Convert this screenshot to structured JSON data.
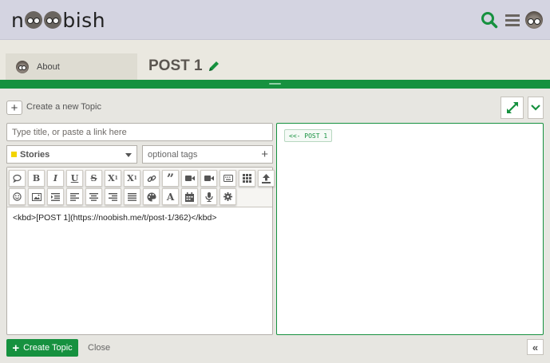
{
  "header": {
    "logo": {
      "prefix": "n",
      "suffix": "bish"
    },
    "icons": [
      "search-icon",
      "hamburger-menu-icon",
      "user-avatar-icon"
    ],
    "accent_color": "#16913f"
  },
  "subheader": {
    "about_label": "About",
    "post_title": "POST 1"
  },
  "composer": {
    "create_topic_link": "Create a new Topic",
    "title_placeholder": "Type title, or paste a link here",
    "category": {
      "name": "Stories",
      "color": "#f2d400"
    },
    "tags_placeholder": "optional tags",
    "toolbar_row1": [
      "speech-bubble-icon",
      "bold-icon",
      "italic-icon",
      "underline-icon",
      "strikethrough-icon",
      "superscript-icon",
      "subscript-icon",
      "link-icon",
      "quote-icon",
      "video-icon",
      "video-alt-icon",
      "keyboard-icon",
      "grid-icon",
      "upload-icon"
    ],
    "toolbar_row2": [
      "emoji-icon",
      "image-icon",
      "indent-icon",
      "align-left-icon",
      "align-center-icon",
      "align-right-icon",
      "justify-icon",
      "palette-icon",
      "font-color-icon",
      "calendar-icon",
      "microphone-icon",
      "settings-icon"
    ],
    "toolbar_labels": {
      "bold": "B",
      "italic": "I",
      "underline": "U",
      "strike": "S",
      "sup": "X",
      "sub": "X",
      "font": "A",
      "quote": "”"
    },
    "editor_text": "<kbd>[POST 1](https://noobish.me/t/post-1/362)</kbd>",
    "preview_kbd": "<<- POST 1",
    "create_button": "Create Topic",
    "close_link": "Close",
    "collapse_label": "«"
  }
}
